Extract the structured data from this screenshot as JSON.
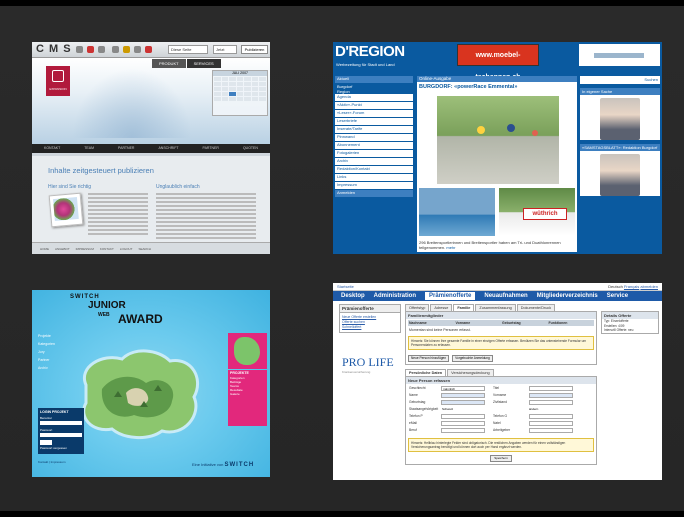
{
  "cms": {
    "logo": "C M S",
    "select_value": "Diese Seite",
    "select2_value": "Jetzt",
    "publish_label": "Publizieren",
    "brand_name": "EXPANSION",
    "nav_top": [
      "PRODUKT",
      "SERVICES"
    ],
    "calendar_title": "JULI 2007",
    "main_nav": [
      "KONTAKT",
      "TEAM",
      "PARTNER",
      "ANSCHRIFT",
      "PARTNER",
      "QUOTEN"
    ],
    "heading": "Inhalte zeitgesteuert publizieren",
    "col1_title": "Hier sind Sie richtig",
    "col2_title": "Unglaublich einfach",
    "footer_links": [
      "HOME",
      "ANGEBOT",
      "IMPRESSUM",
      "KONTAKT",
      "LOGOUT",
      "SEARCH"
    ]
  },
  "dregion": {
    "logo": "D'REGION",
    "subtitle": "Werbezeitung für Stadt und Land",
    "ad_text": "www.moebel-tschannen.ch",
    "nav": [
      {
        "label": "Aktuell",
        "style": "blue"
      },
      {
        "label": "Burgdorf",
        "style": "plain"
      },
      {
        "label": "Region",
        "style": "plain"
      },
      {
        "label": "Agenda",
        "style": "white"
      },
      {
        "label": "«Aktiv»-Punkt",
        "style": "white"
      },
      {
        "label": "«Leser»-Forum",
        "style": "white"
      },
      {
        "label": "Leserbriefe",
        "style": "white"
      },
      {
        "label": "Inserate/Tarife",
        "style": "white"
      },
      {
        "label": "Pinnwand",
        "style": "white"
      },
      {
        "label": "Abonnement",
        "style": "white"
      },
      {
        "label": "Fotogalerien",
        "style": "white"
      },
      {
        "label": "Archiv",
        "style": "white"
      },
      {
        "label": "Redaktion/Kontakt",
        "style": "white"
      },
      {
        "label": "Links",
        "style": "white"
      },
      {
        "label": "Impressum",
        "style": "white"
      },
      {
        "label": "Anmelden",
        "style": "blue"
      }
    ],
    "section_title": "Online-Ausgabe",
    "headline": "BURGDORF: «powerRace Emmental»",
    "banner_text": "wüthrich",
    "caption": "296 Breitensportlerinnen und Breitensportler haben am Tri- und Duathlonrennen teilgenommen.",
    "caption_link": "mehr",
    "search_label": "Suchen",
    "box1_title": "In eigener Sache",
    "box2_title": "«SAMSTAGSBLATT»: Redaktion Burgdorf"
  },
  "jwa": {
    "sponsor": "SWITCH",
    "title_line1": "JUNIOR",
    "title_line2": "WEB",
    "title_line3": "AWARD",
    "left_menu": [
      "Projekte",
      "Kategorien",
      "Jury",
      "Partner",
      "Archiv"
    ],
    "login_title": "LOGIN PROJEKT",
    "login_user_label": "Benutzer",
    "login_pass_label": "Passwort",
    "login_button": "Login",
    "login_forgot": "Passwort vergessen",
    "panel_title": "PROJEKTE",
    "panel_items": [
      "Kategorien",
      "Beiträge",
      "Teams",
      "Resultate",
      "Galerie"
    ],
    "bottom_left": "Kontakt | Impressum",
    "bottom_prefix": "Eine Initiative von",
    "bottom_brand": "SWITCH"
  },
  "prolife": {
    "top_left": "Startseite",
    "top_right_prefix": "Deutsch",
    "top_right_lang": "Français",
    "top_right_logout": "abmelden",
    "menu": [
      "Desktop",
      "Administration",
      "Prämienofferte",
      "Neuaufnahmen",
      "Mitgliederverzeichnis",
      "Service"
    ],
    "menu_active": 2,
    "left_tab": "Prämienofferte",
    "left_links": [
      "Neue Offerte erstellen",
      "Offerte suchen",
      "Schnelloffert"
    ],
    "brand": "PRO LIFE",
    "brand_sub": "Krankenversicherung",
    "tabs": [
      "Offertstyp",
      "Adresse",
      "Familie",
      "Zusammenfassung",
      "Dokumente/Druck"
    ],
    "tab_active": 2,
    "section_title": "Familienmitglieder",
    "table_headers": [
      "Nachname",
      "Vorname",
      "Geburtstag",
      "Funktionen"
    ],
    "empty_text": "Momentan sind keine Personen erfasst.",
    "note_text": "Hinweis: Sie können Ihre gesamte Familie in einer einzigen Offerte erfassen. Benützen Sie das untenstehende Formular um Personendaten zu erfassen.",
    "btn_add": "Neue Person hinzufügen",
    "btn_register": "Vorgebuchte Anmeldung",
    "form_tabs": [
      "Persönliche Daten",
      "Versicherungsdeckung"
    ],
    "form_title": "Neue Person erfassen",
    "form_left_labels": [
      "Geschlecht",
      "Name",
      "Geburtstag",
      "Staatsangehörigkeit",
      "Telefon P",
      "eMail",
      "Beruf"
    ],
    "form_right_labels": [
      "Titel",
      "Vorname",
      "Zivilstand",
      "",
      "Telefon G",
      "Natel",
      "Arbeitgeber"
    ],
    "gender_value": "männlich",
    "nationality_value": "Schweiz",
    "change_label": "ändern",
    "note2_text": "Hinweis: Hellblau hinterlegte Felder sind obligatorisch. Die restlichen Angaben werden für einen vollständigen Versicherungsantrag benötigt und können dort auch per Hand ergänzt werden.",
    "apply_label": "Speichern",
    "right_title": "Details Offerte",
    "right_items": [
      "Typ: Einzelofferte",
      "Erstellen: 4/09",
      "Intersvill Offerte: neu"
    ]
  }
}
